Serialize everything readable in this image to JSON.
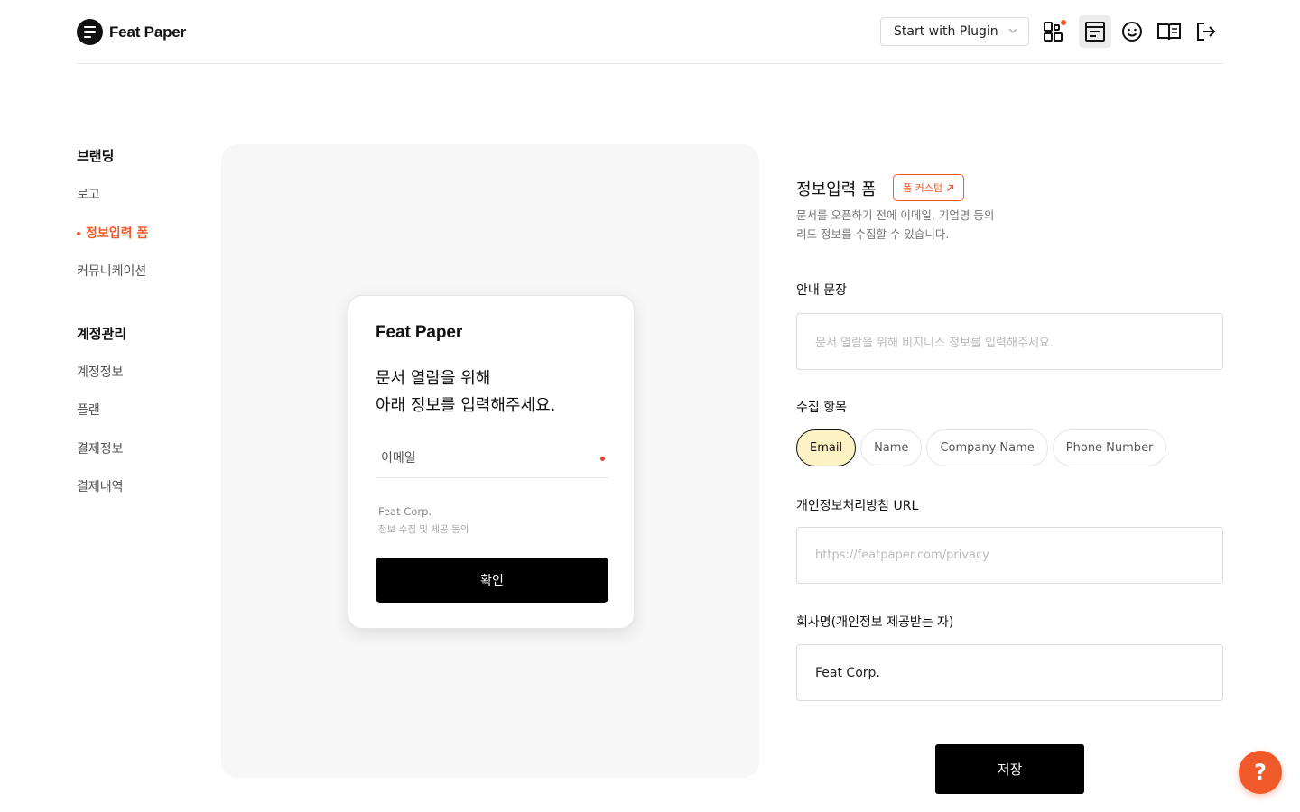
{
  "header": {
    "brand": "Feat Paper",
    "plugin_select": "Start with Plugin",
    "icons": [
      "widgets-icon",
      "form-icon",
      "smile-icon",
      "book-icon",
      "logout-icon"
    ]
  },
  "sidebar": {
    "groups": [
      {
        "title": "브랜딩",
        "items": [
          "로고",
          "정보입력 폼",
          "커뮤니케이션"
        ]
      },
      {
        "title": "계정관리",
        "items": [
          "계정정보",
          "플랜",
          "결제정보",
          "결제내역"
        ]
      }
    ],
    "active_item": "정보입력 폼"
  },
  "preview": {
    "brand": "Feat Paper",
    "message_line1": "문서 열람을 위해",
    "message_line2": "아래 정보를 입력해주세요.",
    "field_label": "이메일",
    "company": "Feat Corp.",
    "consent": "정보 수집 및 제공 동의",
    "confirm_label": "확인"
  },
  "form": {
    "title": "정보입력 폼",
    "customize_label": "폼 커스텀",
    "description_line1": "문서를 오픈하기 전에 이메일, 기업명 등의",
    "description_line2": "리드 정보를 수집할 수 있습니다.",
    "guide_label": "안내 문장",
    "guide_placeholder": "문서 열람을 위해 비지니스 정보를 입력해주세요.",
    "collect_label": "수집 항목",
    "chips": [
      "Email",
      "Name",
      "Company Name",
      "Phone Number"
    ],
    "selected_chip": "Email",
    "privacy_label": "개인정보처리방침 URL",
    "privacy_placeholder": "https://featpaper.com/privacy",
    "company_label": "회사명(개인정보 제공받는 자)",
    "company_value": "Feat Corp.",
    "save_label": "저장"
  },
  "help": {
    "label": "?"
  },
  "colors": {
    "accent": "#f05a2a",
    "chip_selected_bg": "#fdf2c4",
    "button": "#000000"
  }
}
